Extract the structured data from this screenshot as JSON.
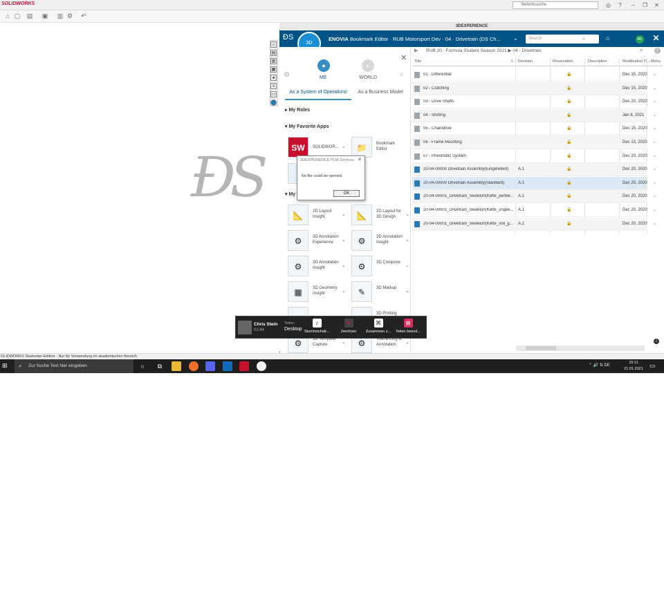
{
  "solidworks": {
    "logo": "SOLIDWORKS",
    "search_placeholder": "Befehlssuche",
    "status_bar": "OLIDWORKS Studenten Edition - Nur für Verwendung im akademischen Bereich"
  },
  "experience": {
    "window_title": "3DEXPERIENCE",
    "brand": "ENOVIA",
    "app_title": "Bookmark Editor · RUB Motorsport Dev · 04 · Drivetrain (DS Ch...",
    "search_placeholder": "Search",
    "avatar_initials": "RK",
    "compass_label": "3D",
    "panel": {
      "me_label": "ME",
      "world_label": "WORLD",
      "tab_ops": "As a System of Operations",
      "tab_biz": "As a Business Model",
      "my_roles": "My Roles",
      "my_fav_apps": "My Favorite Apps",
      "my_apps_partial": "My",
      "favorite_apps": [
        {
          "label": "SOLIDWOR...",
          "icon": "SW"
        },
        {
          "label": "Bookmark Editor",
          "icon": "📁"
        }
      ],
      "apps": [
        {
          "label": "2D Layout Insight",
          "icon": "📐"
        },
        {
          "label": "2D Layout for 3D Design",
          "icon": "📐"
        },
        {
          "label": "3D Annotation Experience",
          "icon": "⚙"
        },
        {
          "label": "3D Annotation Insight",
          "icon": "⚙"
        },
        {
          "label": "3D Annotation Insight",
          "icon": "⚙"
        },
        {
          "label": "3D Compose",
          "icon": "⚙"
        },
        {
          "label": "3D Geometry Insight",
          "icon": "▦"
        },
        {
          "label": "3D Markup",
          "icon": "✎"
        },
        {
          "label": "",
          "icon": "▭"
        },
        {
          "label": "3D Printing",
          "icon": "▭"
        },
        {
          "label": "3D Template Capture",
          "icon": "⚙"
        },
        {
          "label": "Tolerancing & Annotation",
          "icon": "⚙"
        }
      ]
    },
    "dialog": {
      "title": "3DEXPERIENCE PLM Services",
      "message": "No file could be opened.",
      "ok": "OK"
    },
    "breadcrumb": {
      "root": "RUB 20 - Formula Student Season 2021",
      "current": "04 - Drivetrain"
    },
    "columns": [
      "Title",
      "Revision",
      "Reservation",
      "Description",
      "Modification D...",
      "Menu"
    ],
    "rows": [
      {
        "title": "01 - Differential",
        "rev": "",
        "mod": "Dec 15, 2020",
        "type": "folder"
      },
      {
        "title": "02 - Clutching",
        "rev": "",
        "mod": "Dec 15, 2020",
        "type": "folder"
      },
      {
        "title": "03 - Drive Shafts",
        "rev": "",
        "mod": "Dec 20, 2020",
        "type": "folder"
      },
      {
        "title": "04 - Shifting",
        "rev": "",
        "mod": "Jan 6, 2021",
        "type": "folder"
      },
      {
        "title": "05 - Chaindrive",
        "rev": "",
        "mod": "Dec 15, 2020",
        "type": "folder"
      },
      {
        "title": "06 - Frame Mounting",
        "rev": "",
        "mod": "Dec 13, 2020",
        "type": "folder"
      },
      {
        "title": "07 - Pneumatic System",
        "rev": "",
        "mod": "Dec 20, 2020",
        "type": "folder"
      },
      {
        "title": "20-04-00000 Drivetrain Assembly(Eingefedert)",
        "rev": "A.1",
        "mod": "Dec 20, 2020",
        "type": "asm"
      },
      {
        "title": "20-04-00000 Drivetrain Assembly(Standard)",
        "rev": "A.1",
        "mod": "Dec 20, 2020",
        "type": "asm"
      },
      {
        "title": "20-04-00001_Drivetrain_Skeleton(Kette_perfek...",
        "rev": "A.1",
        "mod": "Dec 20, 2020",
        "type": "asm"
      },
      {
        "title": "20-04-00001_Drivetrain_Skeleton(Kette_ungek...",
        "rev": "A.1",
        "mod": "Dec 20, 2020",
        "type": "asm"
      },
      {
        "title": "20-04-00001_Drivetrain_Skeleton(Kette_voll_g...",
        "rev": "A.1",
        "mod": "Dec 20, 2020",
        "type": "asm"
      }
    ]
  },
  "teams": {
    "name": "Chris Stein",
    "time": "01:44",
    "share_label": "Teilen:",
    "share_value": "Desktop",
    "buttons": [
      "Stummschalt...",
      "Zeichnen",
      "Zusammen z...",
      "Teilen beend..."
    ]
  },
  "taskbar": {
    "search_placeholder": "Zur Suche Text hier eingeben",
    "clock_time": "15:11",
    "clock_date": "21.01.2021",
    "lang": "DE"
  }
}
